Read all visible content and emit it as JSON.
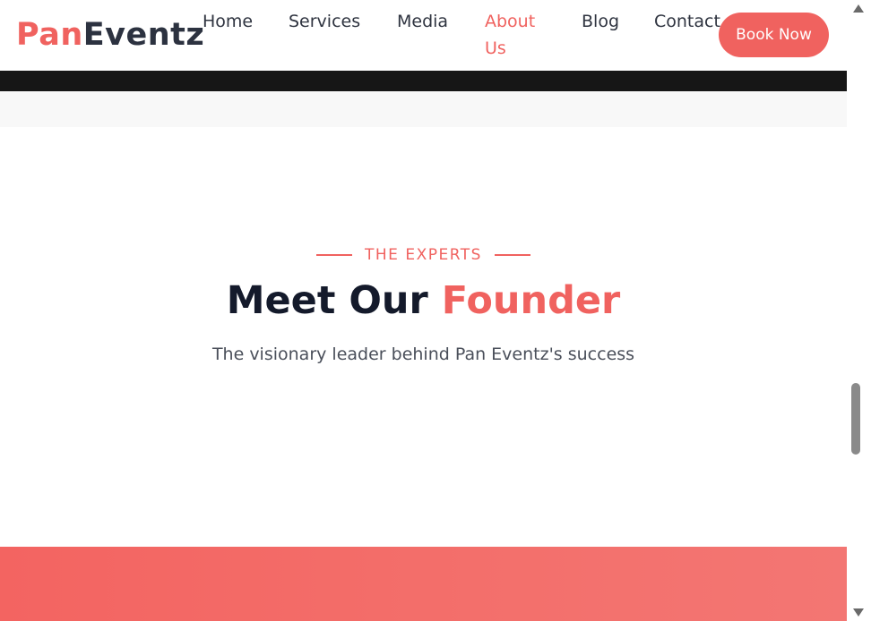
{
  "header": {
    "logo_part1": "Pan",
    "logo_part2": "Eventz",
    "nav": {
      "home": "Home",
      "services": "Services",
      "media": "Media",
      "about": "About Us",
      "blog": "Blog",
      "contact": "Contact"
    },
    "active_nav": "About Us",
    "book_label": "Book Now"
  },
  "section": {
    "eyebrow": "THE EXPERTS",
    "title_part1": "Meet Our",
    "title_part2": "Founder",
    "subtitle": "The visionary leader behind Pan Eventz's success"
  },
  "colors": {
    "accent": "#f0625f",
    "dark": "#141a2b",
    "band_dark": "#161616"
  }
}
